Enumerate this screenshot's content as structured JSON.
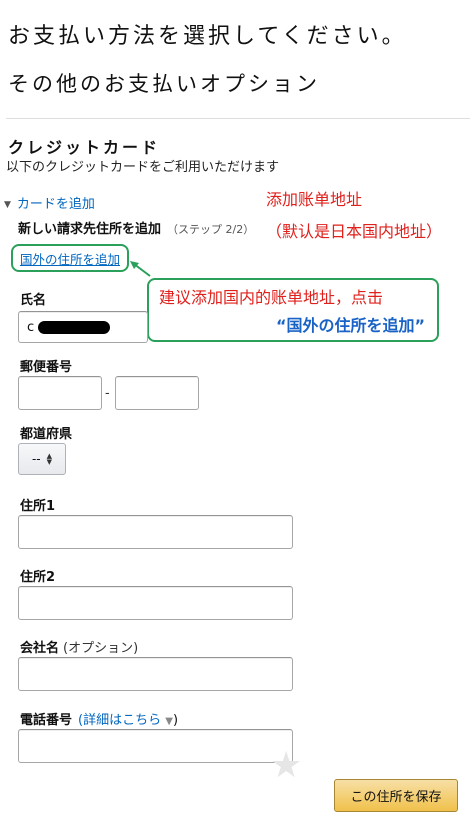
{
  "page": {
    "title": "お支払い方法を選択してください。",
    "other_options": "その他のお支払いオプション"
  },
  "credit_card": {
    "heading": "クレジットカード",
    "description": "以下のクレジットカードをご利用いただけます",
    "add_card_label": "カードを追加",
    "new_address_title": "新しい請求先住所を追加",
    "step_text": "（ステップ 2/2）",
    "foreign_address_link": "国外の住所を追加"
  },
  "form": {
    "name_label": "氏名",
    "name_value": "c",
    "postal_label": "郵便番号",
    "postal_dash": "-",
    "prefecture_label": "都道府県",
    "prefecture_value": "--",
    "address1_label": "住所1",
    "address2_label": "住所2",
    "company_label": "会社名",
    "company_optional": "(オプション)",
    "phone_label": "電話番号",
    "phone_details_link": "(詳細はこちら",
    "phone_details_close": ")",
    "save_button": "この住所を保存"
  },
  "annotations": {
    "note_line1": "添加账单地址",
    "note_line2": "（默认是日本国内地址）",
    "callout_line1": "建议添加国内的账单地址，点击",
    "callout_line2": "“国外の住所を追加”",
    "colors": {
      "red": "#e0201c",
      "green": "#2aa05a",
      "blue": "#1a63c6"
    }
  },
  "icons": {
    "expand": "triangle-down-icon",
    "select_arrows": "up-down-arrows-icon",
    "dropdown_caret": "caret-down-icon",
    "watermark": "star-watermark-icon"
  }
}
